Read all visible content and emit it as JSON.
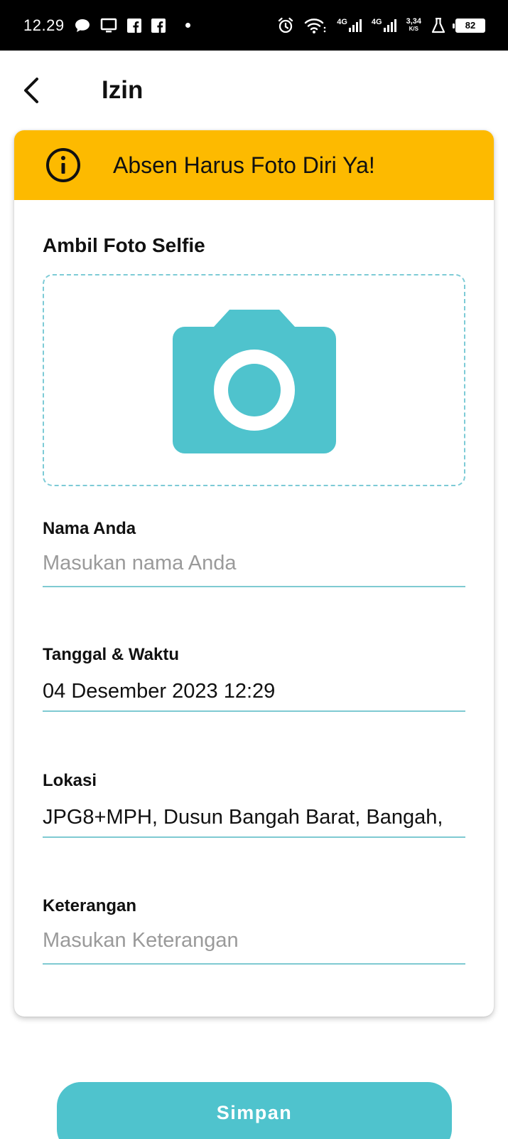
{
  "status_bar": {
    "time": "12.29",
    "network_1": "4G",
    "network_2": "4G",
    "speed_value": "3,34",
    "speed_unit": "K/S",
    "battery": "82"
  },
  "header": {
    "title": "Izin"
  },
  "notice": {
    "text": "Absen Harus Foto Diri Ya!"
  },
  "photo": {
    "label": "Ambil Foto Selfie"
  },
  "form": {
    "name": {
      "label": "Nama Anda",
      "placeholder": "Masukan nama Anda",
      "value": ""
    },
    "datetime": {
      "label": "Tanggal & Waktu",
      "value": "04 Desember 2023 12:29"
    },
    "location": {
      "label": "Lokasi",
      "value": "JPG8+MPH, Dusun Bangah Barat, Bangah,"
    },
    "note": {
      "label": "Keterangan",
      "placeholder": "Masukan Keterangan",
      "value": ""
    }
  },
  "save_button": {
    "label": "Simpan"
  },
  "colors": {
    "accent": "#4FC3CD",
    "notice_bg": "#FDBA00",
    "status_bar_bg": "#000000"
  },
  "icons": [
    "chat-bubble-icon",
    "monitor-icon",
    "facebook-icon",
    "alarm-icon",
    "wifi-icon",
    "signal-icon",
    "flask-icon",
    "battery-icon",
    "back-arrow-icon",
    "info-icon",
    "camera-icon"
  ]
}
